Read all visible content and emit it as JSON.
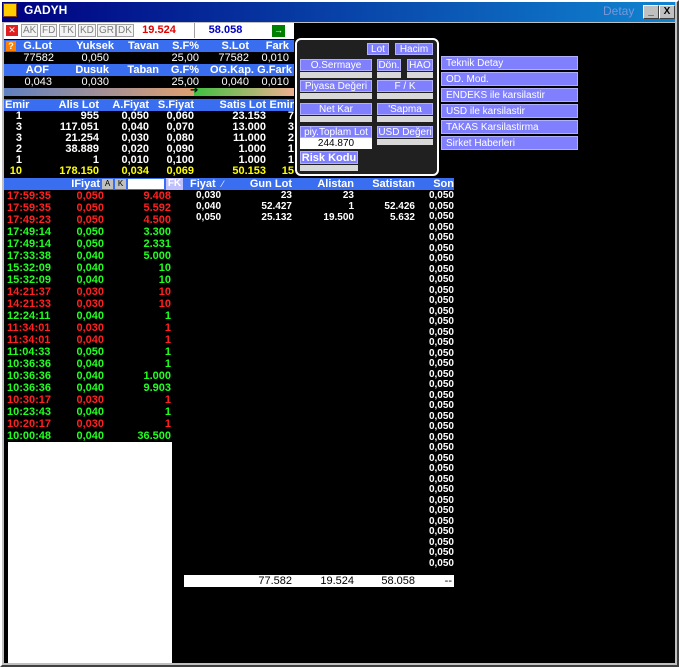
{
  "window": {
    "title": "GADYH",
    "detay_label": "Detay",
    "minimize": "_",
    "close": "X"
  },
  "toolbar": {
    "tabs": [
      "AK",
      "FD",
      "TK",
      "KD",
      "GR",
      "DK"
    ],
    "value1": "19.524",
    "value2": "58.058",
    "arrow": "→"
  },
  "summary": {
    "row1_headers": [
      "G.Lot",
      "Yuksek",
      "Tavan",
      "S.F%",
      "S.Lot",
      "Fark"
    ],
    "row1_values": [
      "77582",
      "0,050",
      "",
      "25,00",
      "77582",
      "0,010"
    ],
    "row2_headers": [
      "AOF",
      "Dusuk",
      "Taban",
      "G.F%",
      "OG.Kap.",
      "G.Fark"
    ],
    "row2_values": [
      "0,043",
      "0,030",
      "",
      "25,00",
      "0,040",
      "0,010"
    ]
  },
  "orderbook": {
    "headers": [
      "Emir",
      "Alis Lot",
      "A.Fiyat",
      "S.Fiyat",
      "Satis Lot",
      "Emir"
    ],
    "rows": [
      [
        "1",
        "955",
        "0,050",
        "0,060",
        "23.153",
        "7"
      ],
      [
        "3",
        "117.051",
        "0,040",
        "0,070",
        "13.000",
        "3"
      ],
      [
        "3",
        "21.254",
        "0,030",
        "0,080",
        "11.000",
        "2"
      ],
      [
        "2",
        "38.889",
        "0,020",
        "0,090",
        "1.000",
        "1"
      ],
      [
        "1",
        "1",
        "0,010",
        "0,100",
        "1.000",
        "1"
      ]
    ],
    "total": [
      "10",
      "178.150",
      "0,034",
      "0,069",
      "50.153",
      "15"
    ]
  },
  "popup": {
    "lot": "Lot",
    "hacim": "Hacim",
    "osermaye": "O.Sermaye",
    "don": "Dön.",
    "hao": "HAO",
    "piyasa": "Piyasa Değeri",
    "fk": "F / K",
    "netkar": "Net Kar",
    "sapma": "'Sapma",
    "piytoplam": "piy.Toplam Lot",
    "piytoplam_val": "244.870",
    "usd": "USD Değeri",
    "risk": "Risk Kodu"
  },
  "menu": [
    "Teknik Detay",
    "OD. Mod.",
    "ENDEKS ile karsilastir",
    "USD ile karsilastir",
    "TAKAS Karsilastirma",
    "Sirket Haberleri"
  ],
  "trades": {
    "headers": {
      "fiyat": "IFiyat",
      "a": "A",
      "k": "K",
      "fk": "FK"
    },
    "rows": [
      {
        "time": "17:59:35",
        "price": "0,050",
        "lot": "9.408",
        "color": "#ff2020"
      },
      {
        "time": "17:59:35",
        "price": "0,050",
        "lot": "5.592",
        "color": "#ff2020"
      },
      {
        "time": "17:49:23",
        "price": "0,050",
        "lot": "4.500",
        "color": "#ff2020"
      },
      {
        "time": "17:49:14",
        "price": "0,050",
        "lot": "3.300",
        "color": "#20ff20"
      },
      {
        "time": "17:49:14",
        "price": "0,050",
        "lot": "2.331",
        "color": "#20ff20"
      },
      {
        "time": "17:33:38",
        "price": "0,040",
        "lot": "5.000",
        "color": "#20ff20"
      },
      {
        "time": "15:32:09",
        "price": "0,040",
        "lot": "10",
        "color": "#20ff20"
      },
      {
        "time": "15:32:09",
        "price": "0,040",
        "lot": "10",
        "color": "#20ff20"
      },
      {
        "time": "14:21:37",
        "price": "0,030",
        "lot": "10",
        "color": "#ff2020"
      },
      {
        "time": "14:21:33",
        "price": "0,030",
        "lot": "10",
        "color": "#ff2020"
      },
      {
        "time": "12:24:11",
        "price": "0,040",
        "lot": "1",
        "color": "#20ff20"
      },
      {
        "time": "11:34:01",
        "price": "0,030",
        "lot": "1",
        "color": "#ff2020"
      },
      {
        "time": "11:34:01",
        "price": "0,040",
        "lot": "1",
        "color": "#ff2020"
      },
      {
        "time": "11:04:33",
        "price": "0,050",
        "lot": "1",
        "color": "#20ff20"
      },
      {
        "time": "10:36:36",
        "price": "0,040",
        "lot": "1",
        "color": "#20ff20"
      },
      {
        "time": "10:36:36",
        "price": "0,040",
        "lot": "1.000",
        "color": "#20ff20"
      },
      {
        "time": "10:36:36",
        "price": "0,040",
        "lot": "9.903",
        "color": "#20ff20"
      },
      {
        "time": "10:30:17",
        "price": "0,030",
        "lot": "1",
        "color": "#ff2020"
      },
      {
        "time": "10:23:43",
        "price": "0,040",
        "lot": "1",
        "color": "#20ff20"
      },
      {
        "time": "10:20:17",
        "price": "0,030",
        "lot": "1",
        "color": "#ff2020"
      },
      {
        "time": "10:00:48",
        "price": "0,040",
        "lot": "36.500",
        "color": "#20ff20"
      }
    ]
  },
  "depth": {
    "headers": [
      "Fiyat",
      "Gun Lot",
      "Alistan",
      "Satistan",
      "Son"
    ],
    "rows": [
      [
        "0,030",
        "23",
        "23",
        ""
      ],
      [
        "0,040",
        "52.427",
        "1",
        "52.426"
      ],
      [
        "0,050",
        "25.132",
        "19.500",
        "5.632"
      ]
    ],
    "son_value": "0,050",
    "son_count": 36,
    "footer": [
      "77.582",
      "19.524",
      "58.058",
      "--"
    ]
  }
}
